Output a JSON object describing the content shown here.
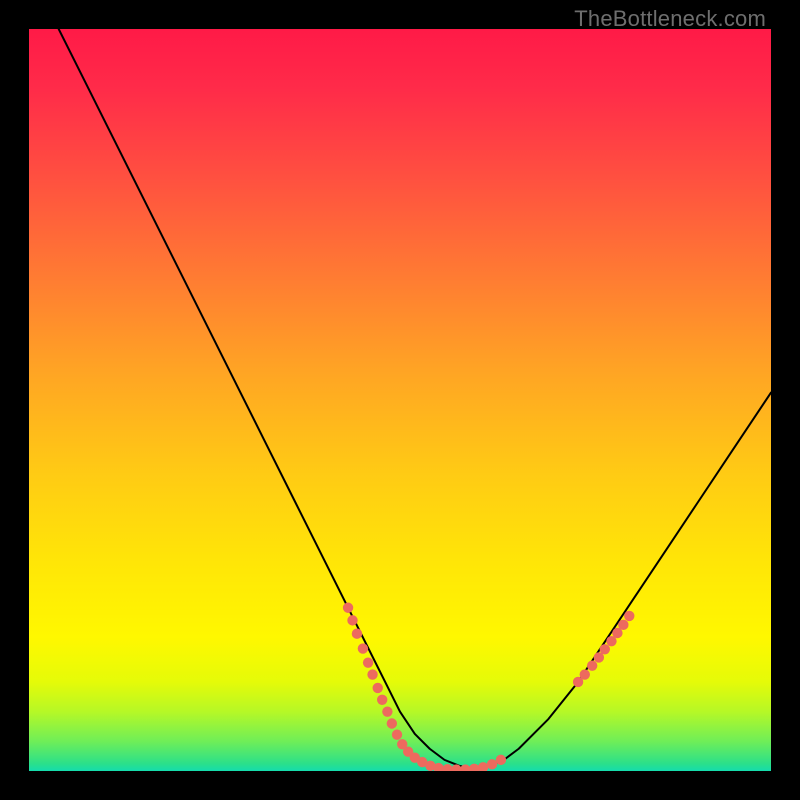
{
  "watermark": {
    "text": "TheBottleneck.com"
  },
  "colors": {
    "background": "#000000",
    "curve": "#000000",
    "marker": "#ed6a5e",
    "gradient_top": "#ff1a47",
    "gradient_bottom": "#14dcad"
  },
  "chart_data": {
    "type": "line",
    "title": "",
    "xlabel": "",
    "ylabel": "",
    "xlim": [
      0,
      100
    ],
    "ylim": [
      0,
      100
    ],
    "grid": false,
    "legend": false,
    "series": [
      {
        "name": "bottleneck-curve",
        "x": [
          4,
          8,
          12,
          16,
          20,
          24,
          28,
          32,
          36,
          40,
          44,
          48,
          50,
          52,
          54,
          56,
          58,
          60,
          62,
          64,
          66,
          70,
          74,
          78,
          82,
          86,
          90,
          94,
          100
        ],
        "y": [
          100,
          92,
          84,
          76,
          68,
          60,
          52,
          44,
          36,
          28,
          20,
          12,
          8,
          5,
          3,
          1.5,
          0.7,
          0.3,
          0.7,
          1.5,
          3,
          7,
          12,
          18,
          24,
          30,
          36,
          42,
          51
        ]
      }
    ],
    "marker_clusters": [
      {
        "name": "left-cluster",
        "points": [
          {
            "x": 43,
            "y": 22
          },
          {
            "x": 43.6,
            "y": 20.3
          },
          {
            "x": 44.2,
            "y": 18.5
          },
          {
            "x": 45.0,
            "y": 16.5
          },
          {
            "x": 45.7,
            "y": 14.6
          },
          {
            "x": 46.3,
            "y": 13.0
          },
          {
            "x": 47.0,
            "y": 11.2
          },
          {
            "x": 47.6,
            "y": 9.6
          },
          {
            "x": 48.3,
            "y": 8.0
          },
          {
            "x": 48.9,
            "y": 6.4
          },
          {
            "x": 49.6,
            "y": 4.9
          },
          {
            "x": 50.3,
            "y": 3.6
          },
          {
            "x": 51.1,
            "y": 2.6
          },
          {
            "x": 52.0,
            "y": 1.8
          },
          {
            "x": 53.0,
            "y": 1.2
          },
          {
            "x": 54.1,
            "y": 0.7
          },
          {
            "x": 55.2,
            "y": 0.4
          },
          {
            "x": 56.4,
            "y": 0.25
          },
          {
            "x": 57.6,
            "y": 0.2
          },
          {
            "x": 58.8,
            "y": 0.2
          },
          {
            "x": 60.0,
            "y": 0.3
          },
          {
            "x": 61.2,
            "y": 0.5
          },
          {
            "x": 62.4,
            "y": 0.9
          },
          {
            "x": 63.6,
            "y": 1.5
          }
        ]
      },
      {
        "name": "right-cluster",
        "points": [
          {
            "x": 74.0,
            "y": 12.0
          },
          {
            "x": 74.9,
            "y": 13.0
          },
          {
            "x": 75.9,
            "y": 14.2
          },
          {
            "x": 76.8,
            "y": 15.3
          },
          {
            "x": 77.6,
            "y": 16.4
          },
          {
            "x": 78.5,
            "y": 17.5
          },
          {
            "x": 79.3,
            "y": 18.6
          },
          {
            "x": 80.1,
            "y": 19.7
          },
          {
            "x": 80.9,
            "y": 20.9
          }
        ]
      }
    ]
  }
}
